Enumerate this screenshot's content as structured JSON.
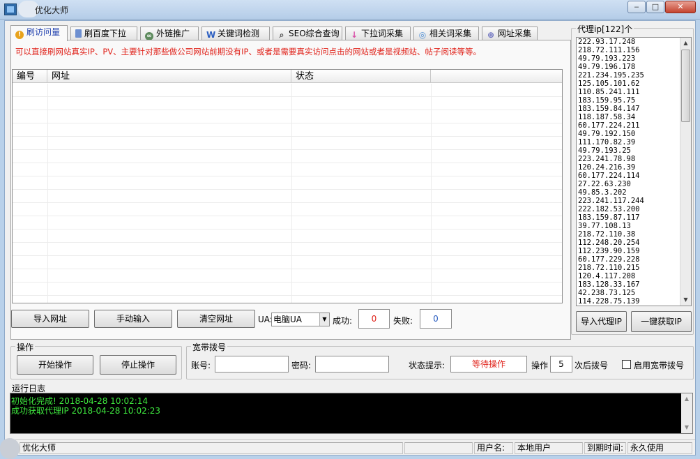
{
  "window": {
    "title": "优化大师",
    "min_glyph": "‒",
    "max_glyph": "□",
    "close_glyph": "✕"
  },
  "tabs": [
    {
      "label": "刷访问量",
      "icon": "alert-icon",
      "color": "#e8a21c",
      "glyph": "!"
    },
    {
      "label": "刷百度下拉",
      "icon": "page-icon",
      "color": "#6d8fd0",
      "glyph": ""
    },
    {
      "label": "外链推广",
      "icon": "link-icon",
      "color": "#5d8a5d",
      "glyph": "∞"
    },
    {
      "label": "关键词检测",
      "icon": "w-icon",
      "color": "#2a5dc0",
      "glyph": "W"
    },
    {
      "label": "SEO综合查询",
      "icon": "magnifier-icon",
      "color": "#666666",
      "glyph": "⌕"
    },
    {
      "label": "下拉词采集",
      "icon": "down-arrow-icon",
      "color": "#d94fa7",
      "glyph": "↓"
    },
    {
      "label": "相关词采集",
      "icon": "globe-icon",
      "color": "#4f8fd6",
      "glyph": "◎"
    },
    {
      "label": "网址采集",
      "icon": "link-globe-icon",
      "color": "#6a6fbf",
      "glyph": "⊕"
    }
  ],
  "info_text": "可以直接刷网站真实IP、PV、主要针对那些做公司网站前期没有IP、或者是需要真实访问点击的网站或者是视频站、帖子阅读等等。",
  "table": {
    "columns": [
      "编号",
      "网址",
      "状态"
    ]
  },
  "url_buttons": {
    "import": "导入网址",
    "manual": "手动输入",
    "clear": "清空网址"
  },
  "ua": {
    "label": "UA:",
    "value": "电脑UA"
  },
  "counts": {
    "success_label": "成功:",
    "success_value": "0",
    "fail_label": "失败:",
    "fail_value": "0"
  },
  "proxy": {
    "title": "代理ip[122]个",
    "items": [
      "222.93.17.248",
      "218.72.111.156",
      "49.79.193.223",
      "49.79.196.178",
      "221.234.195.235",
      "125.105.101.62",
      "110.85.241.111",
      "183.159.95.75",
      "183.159.84.147",
      "118.187.58.34",
      "60.177.224.211",
      "49.79.192.150",
      "111.170.82.39",
      "49.79.193.25",
      "223.241.78.98",
      "120.24.216.39",
      "60.177.224.114",
      "27.22.63.230",
      "49.85.3.202",
      "223.241.117.244",
      "222.182.53.200",
      "183.159.87.117",
      "39.77.108.13",
      "218.72.110.38",
      "112.248.20.254",
      "112.239.90.159",
      "60.177.229.228",
      "218.72.110.215",
      "120.4.117.208",
      "183.128.33.167",
      "42.238.73.125",
      "114.228.75.139"
    ],
    "import_button": "导入代理IP",
    "fetch_button": "一键获取IP"
  },
  "operation": {
    "title": "操作",
    "start": "开始操作",
    "stop": "停止操作"
  },
  "broadband": {
    "title": "宽带拨号",
    "account_label": "账号:",
    "account_value": "",
    "password_label": "密码:",
    "password_value": "",
    "status_label": "状态提示:",
    "status_value": "等待操作",
    "op_label": "操作",
    "op_count": "5",
    "op_suffix": "次后拨号",
    "enable_label": "启用宽带拨号"
  },
  "log": {
    "title": "运行日志",
    "lines": [
      "初始化完成!  2018-04-28 10:02:14",
      "成功获取代理IP 2018-04-28 10:02:23"
    ]
  },
  "statusbar": {
    "app": "优化大师",
    "user_label": "用户名:",
    "user_value": "本地用户",
    "expire_label": "到期时间:",
    "expire_value": "永久使用"
  },
  "colors": {
    "accent_red": "#e0221a",
    "log_green": "#3ee73e",
    "status_red": "#e0221a",
    "count_blue": "#2a5dc0"
  }
}
